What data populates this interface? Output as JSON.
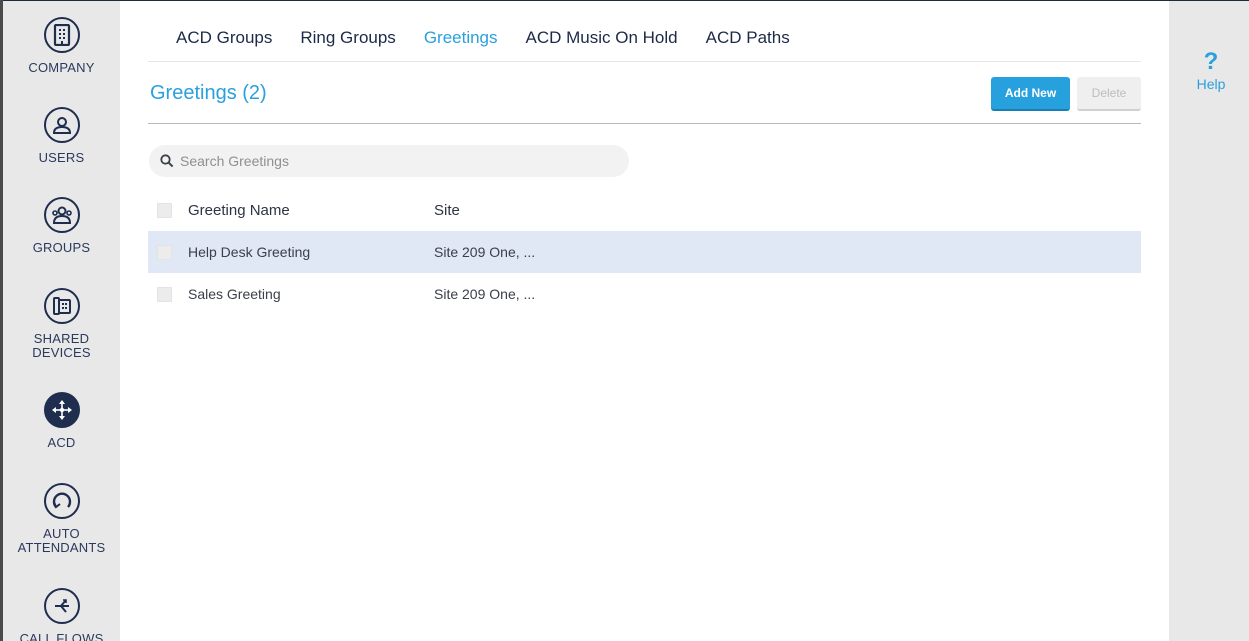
{
  "sidebar": {
    "items": [
      {
        "label": "COMPANY",
        "icon": "building-icon"
      },
      {
        "label": "USERS",
        "icon": "user-icon"
      },
      {
        "label": "GROUPS",
        "icon": "group-icon"
      },
      {
        "label": "SHARED\nDEVICES",
        "icon": "phone-device-icon"
      },
      {
        "label": "ACD",
        "icon": "acd-arrows-icon",
        "active": true
      },
      {
        "label": "AUTO\nATTENDANTS",
        "icon": "auto-attendant-icon"
      },
      {
        "label": "CALL FLOWS",
        "icon": "call-flow-icon"
      }
    ]
  },
  "tabs": [
    {
      "label": "ACD Groups"
    },
    {
      "label": "Ring Groups"
    },
    {
      "label": "Greetings",
      "active": true
    },
    {
      "label": "ACD Music On Hold"
    },
    {
      "label": "ACD Paths"
    }
  ],
  "header": {
    "title": "Greetings (2)",
    "add_label": "Add New",
    "delete_label": "Delete"
  },
  "search": {
    "placeholder": "Search Greetings",
    "value": ""
  },
  "table": {
    "columns": [
      "Greeting Name",
      "Site"
    ],
    "rows": [
      {
        "name": "Help Desk Greeting",
        "site": "Site 209 One, ...",
        "highlighted": true
      },
      {
        "name": "Sales Greeting",
        "site": "Site 209 One, ...",
        "highlighted": false
      }
    ]
  },
  "help": {
    "label": "Help",
    "icon": "question-mark-icon"
  },
  "colors": {
    "accent": "#2aa0dd",
    "navy": "#1f2d4e",
    "selected_row": "#e0e8f6"
  }
}
